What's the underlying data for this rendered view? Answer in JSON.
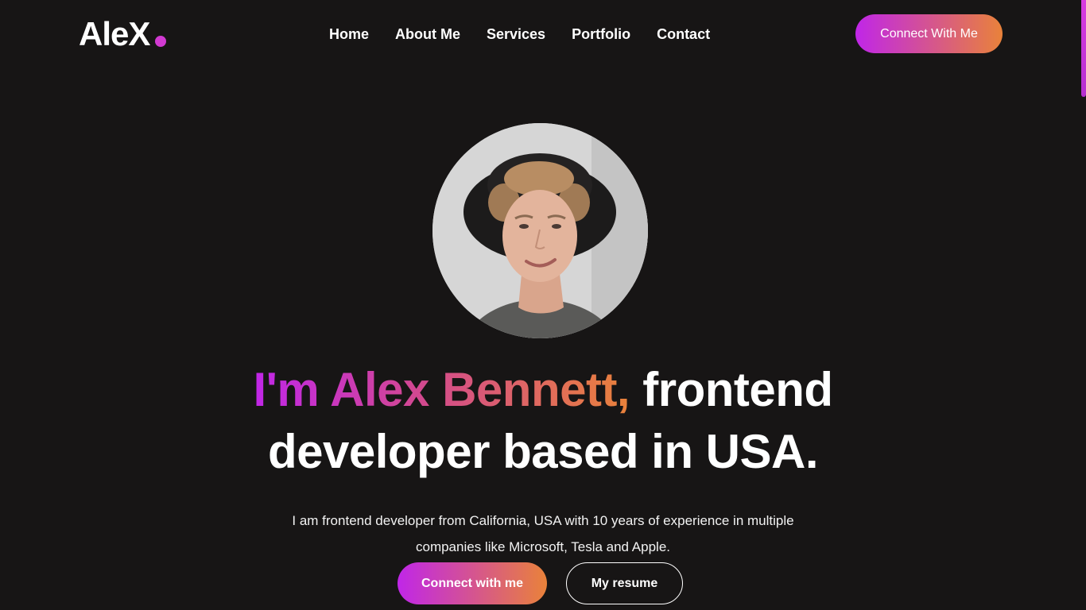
{
  "header": {
    "logo_text": "AleX",
    "nav": {
      "home": "Home",
      "about": "About Me",
      "services": "Services",
      "portfolio": "Portfolio",
      "contact": "Contact"
    },
    "cta_label": "Connect With Me"
  },
  "hero": {
    "headline_highlight": "I'm Alex Bennett,",
    "headline_rest_line1": " frontend",
    "headline_line2": "developer based in USA.",
    "description": "I am frontend developer from California, USA with 10 years of experience in multiple companies like Microsoft, Tesla and Apple.",
    "primary_cta": "Connect with me",
    "secondary_cta": "My resume"
  },
  "colors": {
    "background": "#171515",
    "gradient_start": "#c026e8",
    "gradient_end": "#e9823a",
    "text": "#ffffff"
  }
}
